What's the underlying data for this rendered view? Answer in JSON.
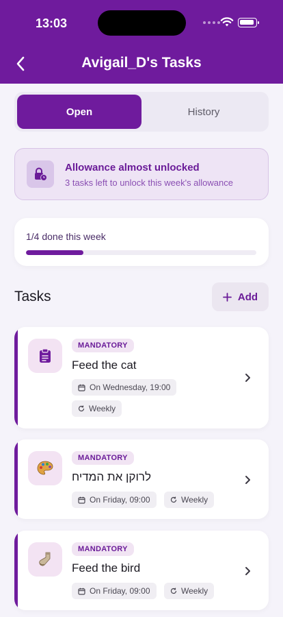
{
  "status_bar": {
    "time": "13:03"
  },
  "header": {
    "title": "Avigail_D's Tasks"
  },
  "tabs": {
    "open": "Open",
    "history": "History"
  },
  "banner": {
    "title": "Allowance almost unlocked",
    "subtitle": "3 tasks left to unlock this week's allowance"
  },
  "progress": {
    "label": "1/4 done this week",
    "fraction": 0.25
  },
  "tasks_section": {
    "heading": "Tasks",
    "add_label": "Add"
  },
  "tasks": [
    {
      "badge": "MANDATORY",
      "name": "Feed the cat",
      "schedule": "On Wednesday, 19:00",
      "recurrence": "Weekly",
      "icon": "clipboard-icon"
    },
    {
      "badge": "MANDATORY",
      "name": "לרוקן את המדיח",
      "schedule": "On Friday, 09:00",
      "recurrence": "Weekly",
      "icon": "palette-icon"
    },
    {
      "badge": "MANDATORY",
      "name": "Feed the bird",
      "schedule": "On Friday, 09:00",
      "recurrence": "Weekly",
      "icon": "sock-icon"
    }
  ],
  "colors": {
    "primary": "#6f1b9d",
    "background": "#f5f3fa",
    "banner_bg": "#eee4f5"
  }
}
